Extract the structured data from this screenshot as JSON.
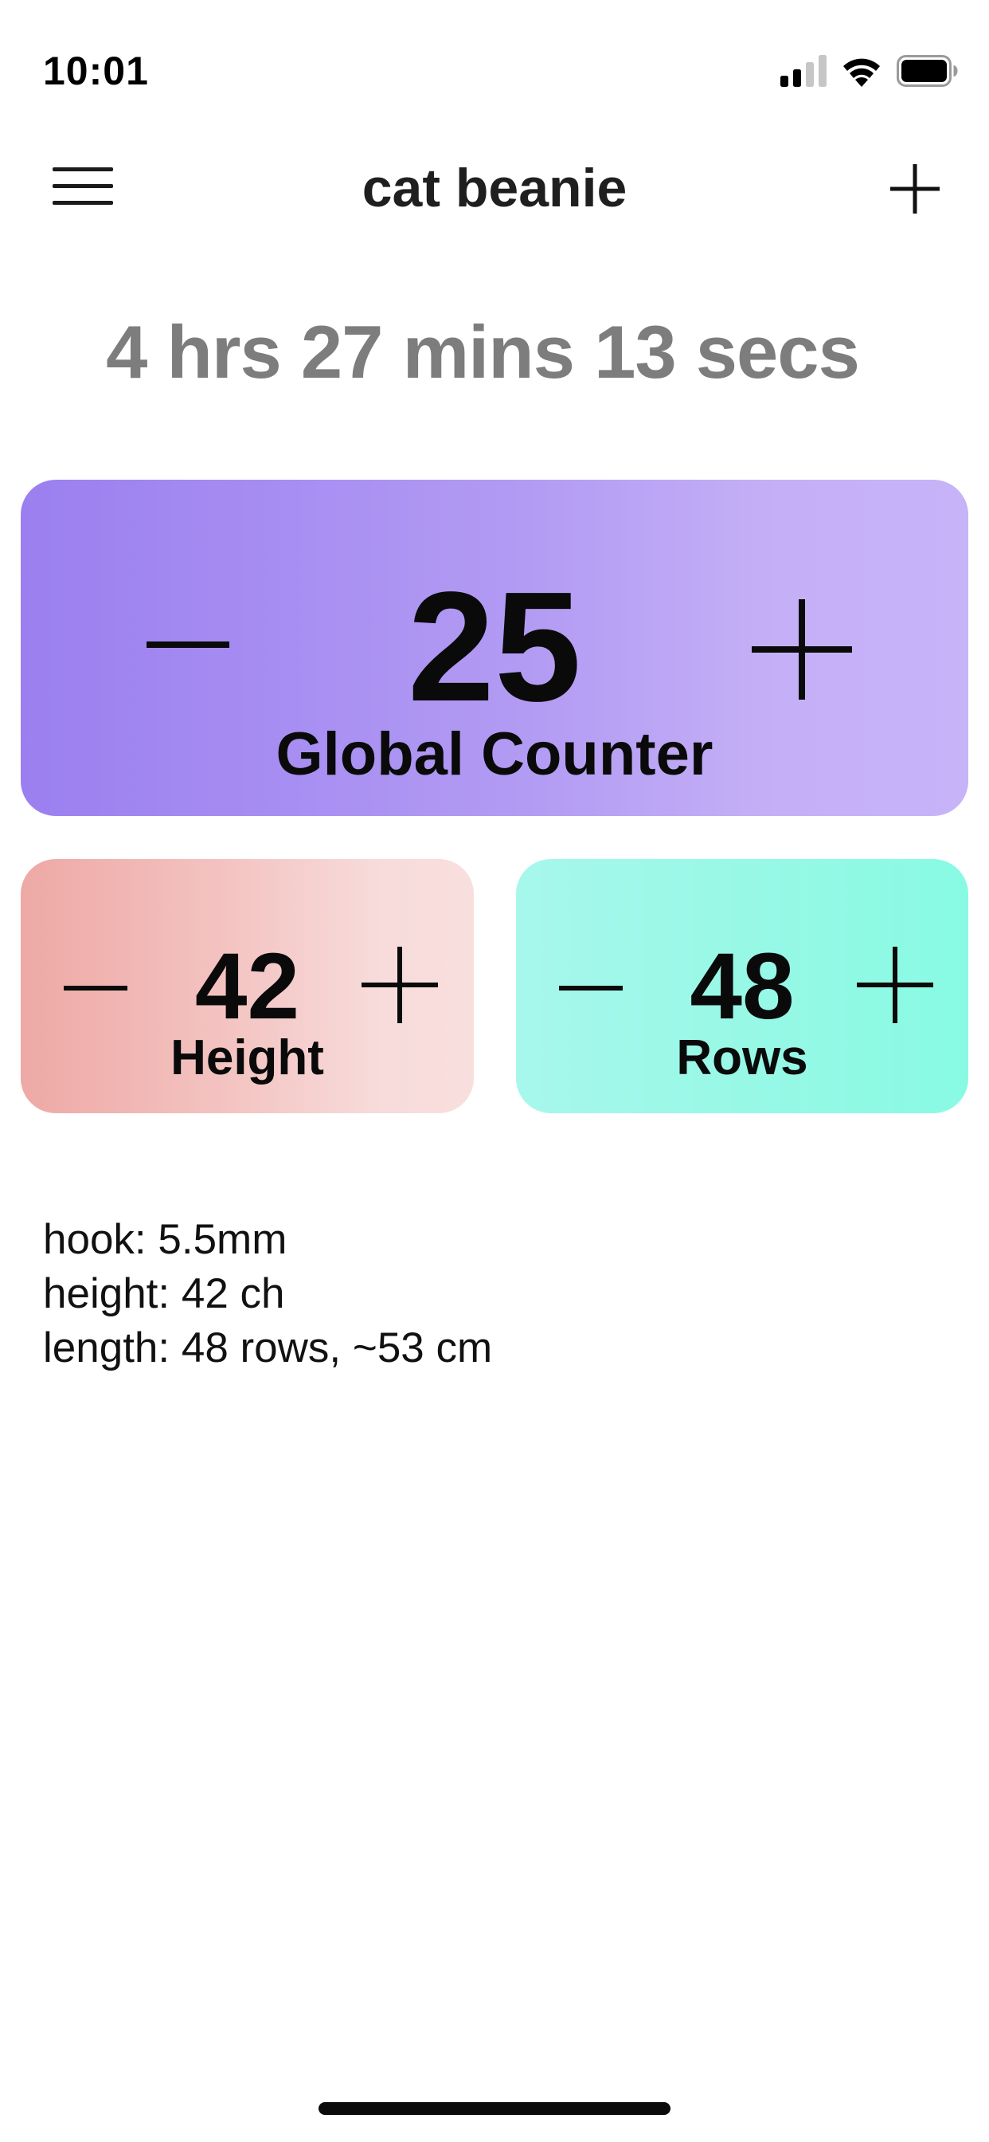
{
  "status_bar": {
    "time": "10:01",
    "icons": [
      "cellular-signal-icon",
      "wifi-icon",
      "battery-icon"
    ]
  },
  "nav": {
    "title": "cat beanie",
    "menu_icon": "hamburger-menu-icon",
    "add_icon": "plus-icon"
  },
  "timer": {
    "text": "4 hrs 27 mins 13 secs"
  },
  "counters": {
    "global": {
      "value": "25",
      "label": "Global Counter",
      "gradient": [
        "#9b7ff0",
        "#c7b3f8"
      ]
    },
    "height": {
      "value": "42",
      "label": "Height",
      "gradient": [
        "#eea9a5",
        "#f8dedd"
      ]
    },
    "rows": {
      "value": "48",
      "label": "Rows",
      "gradient": [
        "#a7f7ec",
        "#88fae3"
      ]
    }
  },
  "notes": {
    "lines": [
      "hook: 5.5mm",
      "height: 42 ch",
      "length: 48 rows, ~53 cm"
    ]
  },
  "colors": {
    "timer_text": "#7d7d7d",
    "text": "#000000",
    "background": "#ffffff"
  }
}
